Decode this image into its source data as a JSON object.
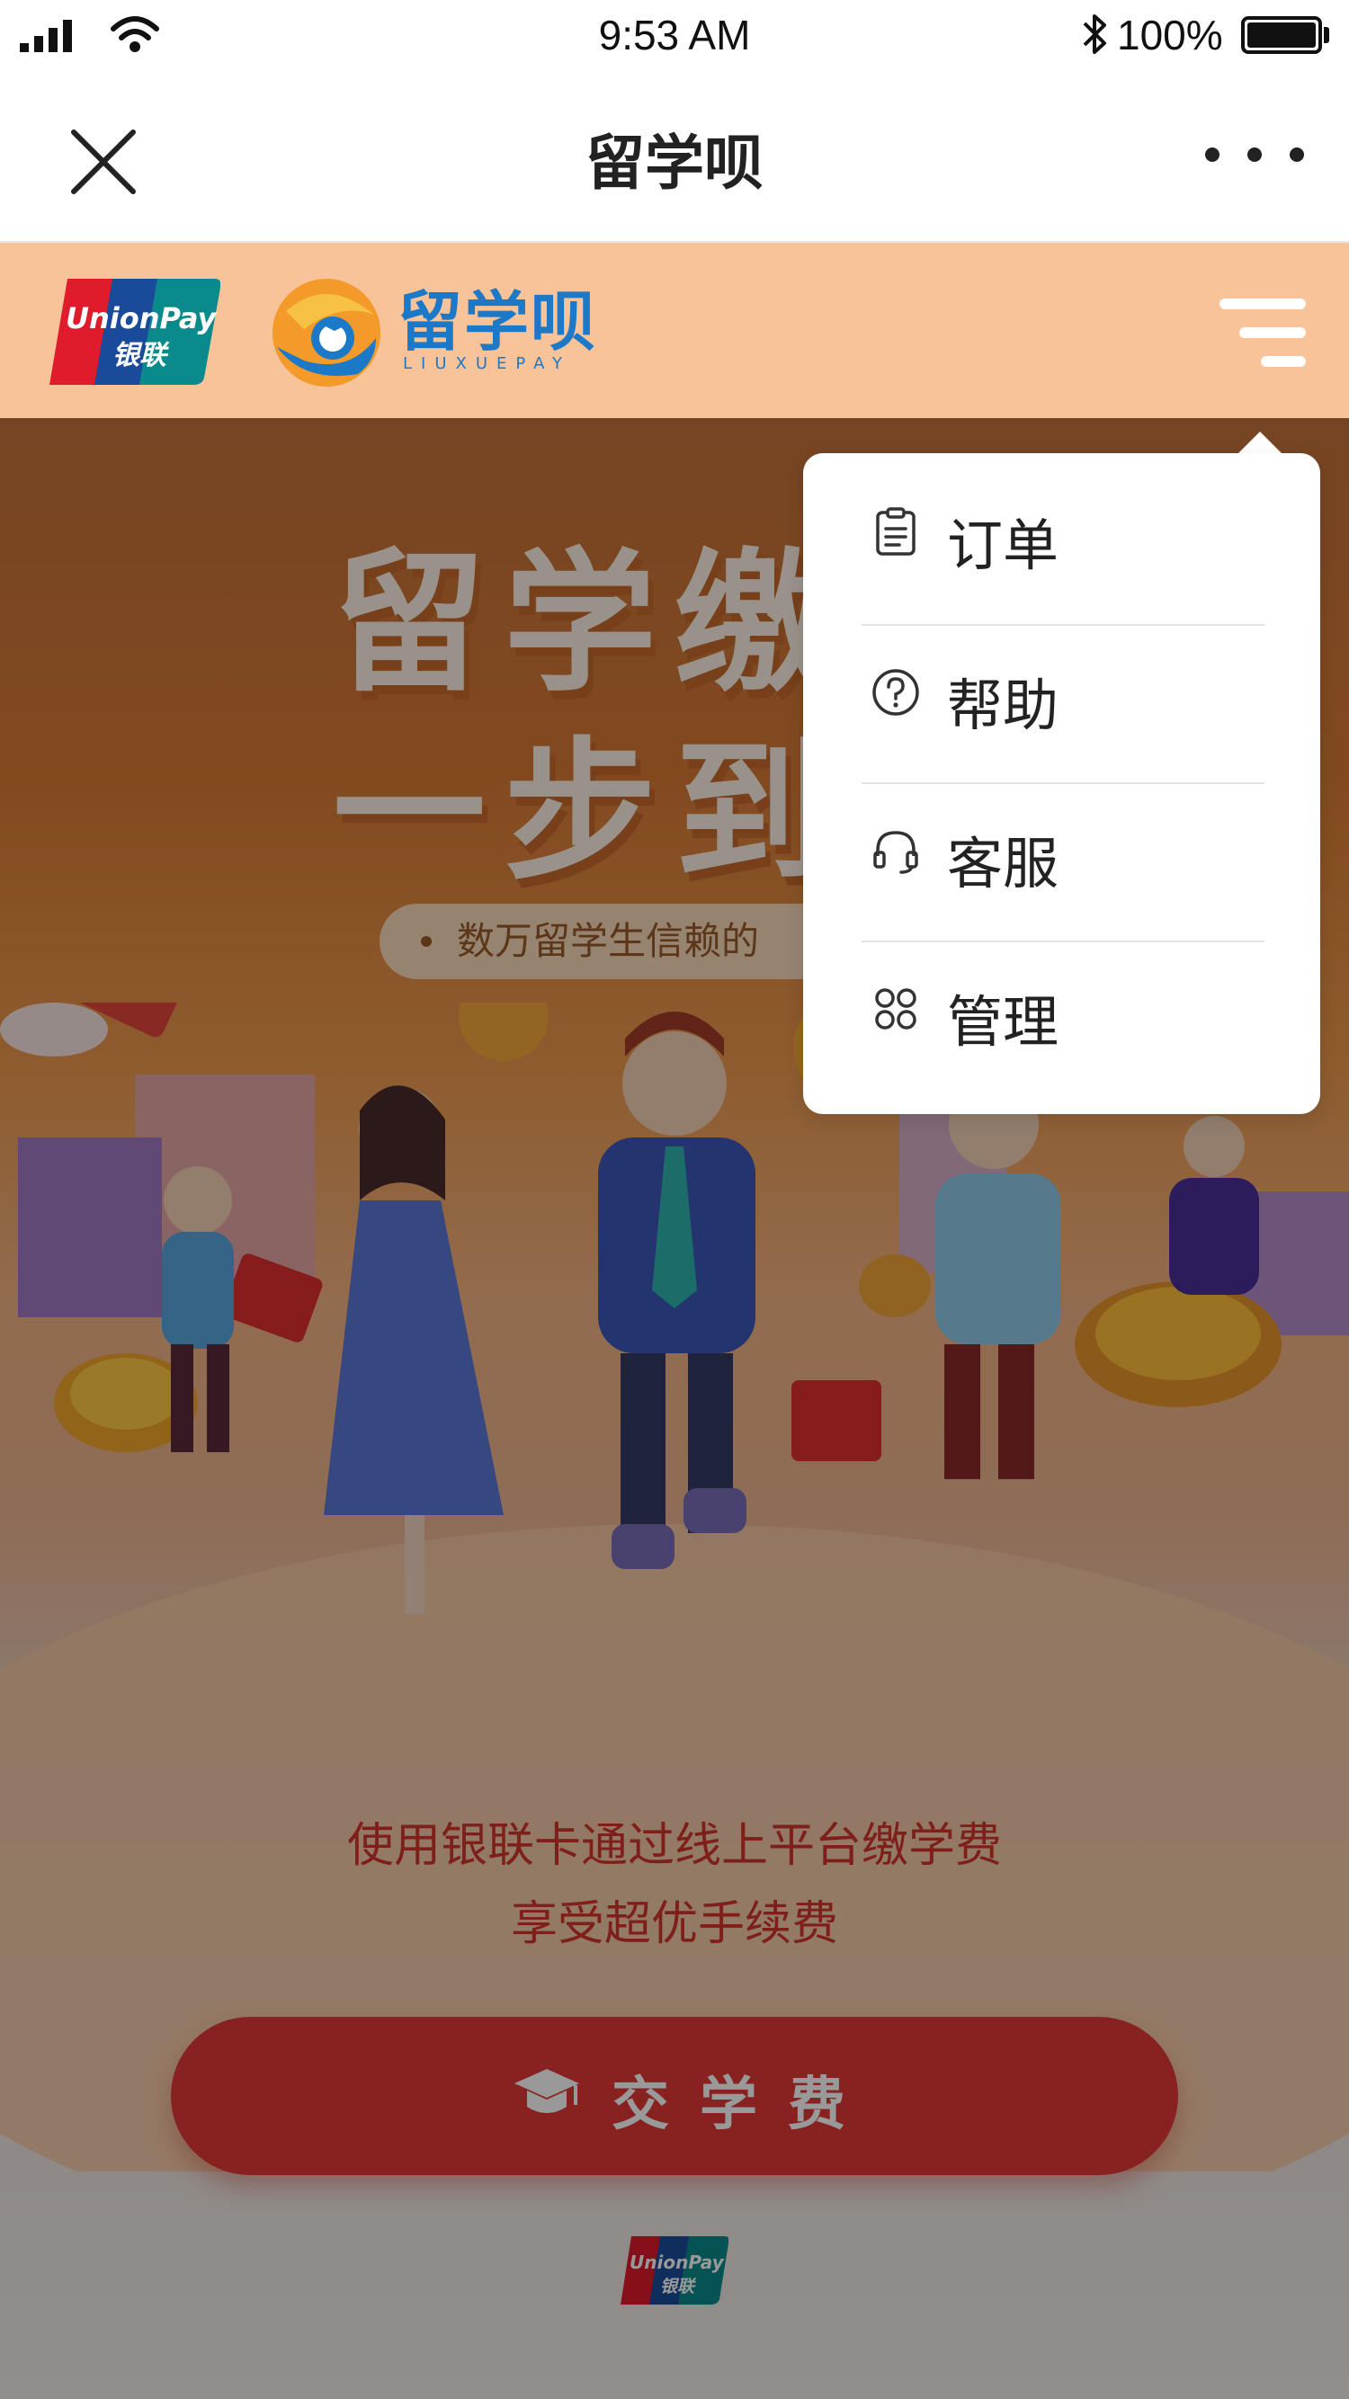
{
  "status_bar": {
    "time": "9:53 AM",
    "battery": "100%",
    "icons": [
      "cellular-signal-icon",
      "wifi-icon",
      "bluetooth-icon",
      "battery-icon"
    ]
  },
  "nav": {
    "title": "留学呗",
    "close_icon": "close-icon",
    "more_icon": "more-icon"
  },
  "header": {
    "unionpay_logo_text": [
      "UnionPay",
      "银联"
    ],
    "brand_text": "留学呗",
    "brand_subtext": "LIUXUEPAY",
    "menu_icon": "menu-icon"
  },
  "hero": {
    "line1": "留学缴",
    "line2": "一步到",
    "tagline": "数万留学生信赖的"
  },
  "slogan": {
    "line1": "使用银联卡通过线上平台缴学费",
    "line2": "享受超优手续费"
  },
  "pay_button": {
    "label": "交学费",
    "icon": "graduation-cap-icon"
  },
  "dropdown": {
    "items": [
      {
        "label": "订单",
        "icon": "clipboard-icon"
      },
      {
        "label": "帮助",
        "icon": "help-icon"
      },
      {
        "label": "客服",
        "icon": "headset-icon"
      },
      {
        "label": "管理",
        "icon": "manage-icon"
      }
    ]
  },
  "colors": {
    "header_bg": "#f9c39a",
    "brand_blue": "#1b79c8",
    "accent_red": "#e23a37",
    "overlay": "rgba(0,0,0,0.40)"
  }
}
